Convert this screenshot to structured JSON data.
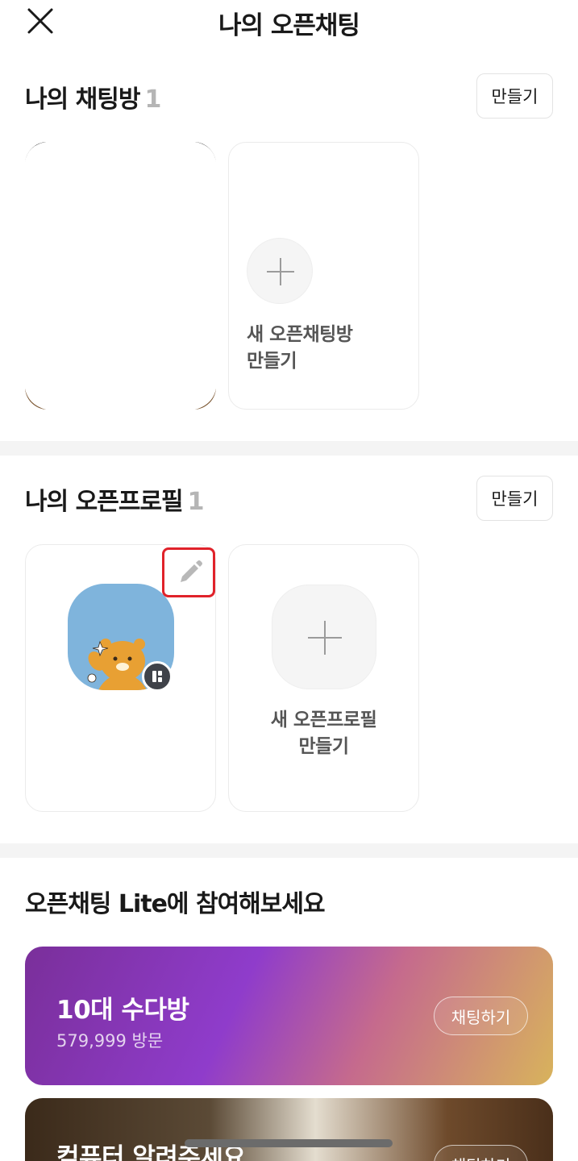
{
  "header": {
    "title": "나의 오픈채팅"
  },
  "chatrooms": {
    "title": "나의 채팅방",
    "count": "1",
    "make_label": "만들기",
    "new_line1": "새 오픈채팅방",
    "new_line2": "만들기"
  },
  "profiles": {
    "title": "나의 오픈프로필",
    "count": "1",
    "make_label": "만들기",
    "new_line1": "새 오픈프로필",
    "new_line2": "만들기"
  },
  "lite": {
    "title": "오픈채팅 Lite에 참여해보세요",
    "rooms": [
      {
        "name": "10대 수다방",
        "visits": "579,999 방문",
        "action": "채팅하기"
      },
      {
        "name": "컴퓨터 알려주세요",
        "action": "채팅하기"
      }
    ]
  },
  "colors": {
    "accent_highlight": "#e0222a",
    "avatar_bg": "#7fb4dc",
    "character": "#e8a033"
  },
  "icons": [
    "close-icon",
    "plus-icon",
    "pencil-icon",
    "profile-badge-icon"
  ]
}
